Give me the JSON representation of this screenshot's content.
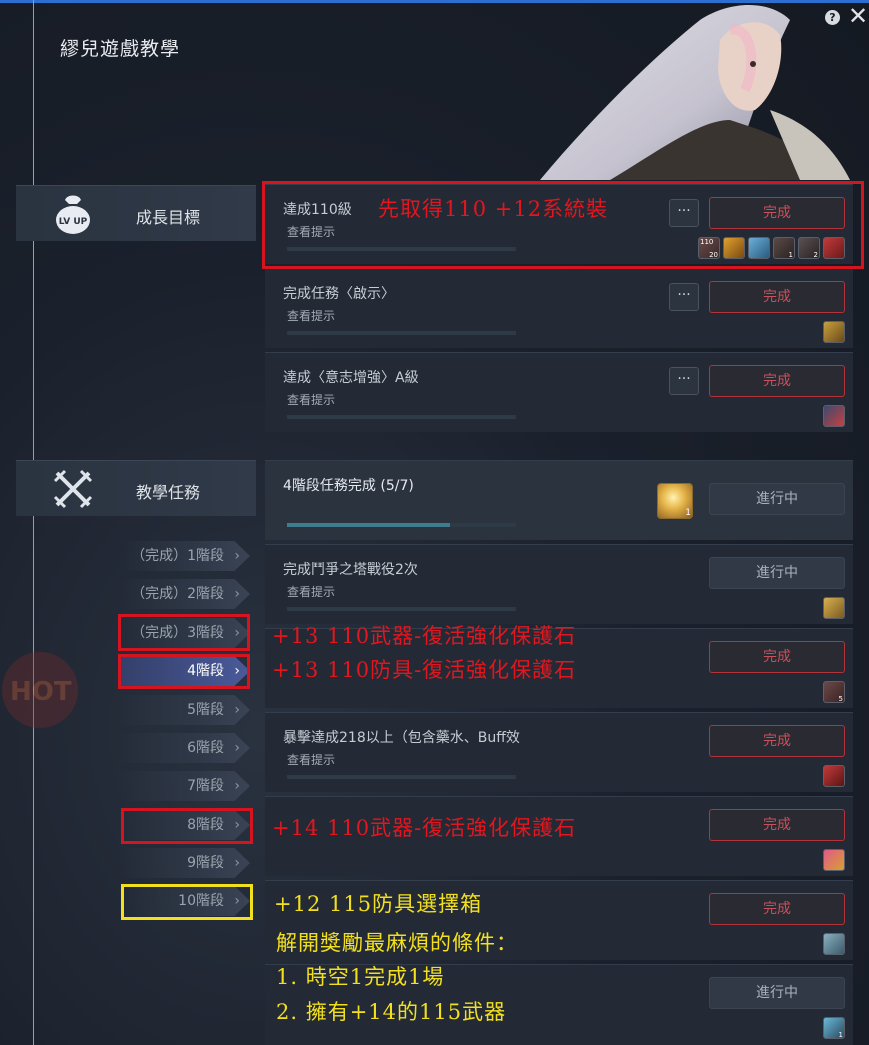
{
  "window": {
    "title": "繆兒遊戲教學",
    "help_label": "?",
    "close_label": "✕"
  },
  "sections": {
    "growth": {
      "label": "成長目標",
      "icon_text": "LV UP"
    },
    "tutorial": {
      "label": "教學任務"
    }
  },
  "growth_tasks": [
    {
      "name": "達成110級",
      "hint": "查看提示",
      "more": "···",
      "button": "完成"
    },
    {
      "name": "完成任務〈啟示〉",
      "hint": "查看提示",
      "more": "···",
      "button": "完成"
    },
    {
      "name": "達成〈意志增強〉A級",
      "hint": "查看提示",
      "more": "···",
      "button": "完成"
    }
  ],
  "stage_summary": {
    "name": "4階段任務完成 (5/7)",
    "button": "進行中",
    "reward_count": "1",
    "progress": 0.71
  },
  "stage_tasks": [
    {
      "name": "完成鬥爭之塔戰役2次",
      "hint": "查看提示",
      "button": "進行中"
    },
    {
      "button": "完成",
      "reward_count": "5"
    },
    {
      "name": "暴擊達成218以上（包含藥水、Buff效",
      "hint": "查看提示",
      "button": "完成"
    },
    {
      "button": "完成"
    },
    {
      "button": "完成"
    },
    {
      "button": "進行中",
      "reward_count": "1"
    }
  ],
  "stages": [
    {
      "label": "（完成）1階段"
    },
    {
      "label": "（完成）2階段"
    },
    {
      "label": "（完成）3階段"
    },
    {
      "label": "4階段"
    },
    {
      "label": "5階段"
    },
    {
      "label": "6階段"
    },
    {
      "label": "7階段"
    },
    {
      "label": "8階段"
    },
    {
      "label": "9階段"
    },
    {
      "label": "10階段"
    }
  ],
  "rewards_row1": [
    "20",
    "",
    "",
    "1",
    "2",
    ""
  ],
  "rewards_row1_top": "110",
  "annotations": {
    "a1": "先取得110 +12系統裝",
    "a2": "+13 110武器-復活強化保護石",
    "a3": "+13 110防具-復活強化保護石",
    "a4": "+14 110武器-復活強化保護石",
    "a5": "+12 115防具選擇箱",
    "a6": "解開獎勵最麻煩的條件：",
    "a7": "1. 時空1完成1場",
    "a8": "2. 擁有+14的115武器"
  },
  "colors": {
    "accent_line": "#c89a3c",
    "red_button": "#b2343a",
    "annotation_red": "#e2161e",
    "annotation_yellow": "#f2e01f",
    "active_stage": "#4a5a9a"
  }
}
